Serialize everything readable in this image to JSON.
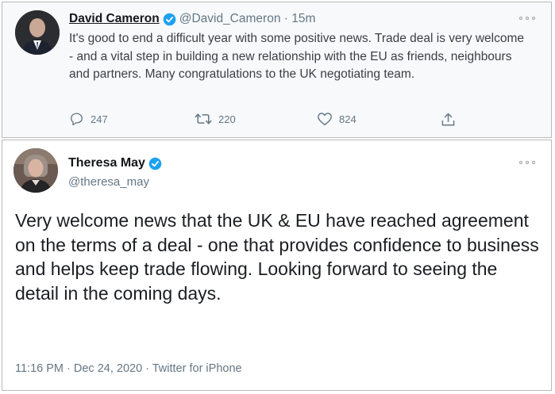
{
  "tweet1": {
    "name": "David Cameron",
    "handle": "@David_Cameron · 15m",
    "text": "It's good to end a difficult year with some positive news. Trade deal is very welcome - and a vital step in building a new relationship with the EU as friends, neighbours and partners. Many congratulations to the UK negotiating team.",
    "actions": {
      "replies": "247",
      "retweets": "220",
      "likes": "824"
    }
  },
  "tweet2": {
    "name": "Theresa May",
    "handle": "@theresa_may",
    "text": "Very welcome news that the UK & EU have reached agreement on the terms of a deal - one that provides confidence to business and helps keep trade flowing. Looking forward to seeing the detail in the coming days.",
    "meta": "11:16 PM · Dec 24, 2020 · Twitter for iPhone"
  },
  "icons": {
    "verified": "verified-badge-icon",
    "reply": "reply-icon",
    "retweet": "retweet-icon",
    "like": "heart-icon",
    "share": "share-icon",
    "more": "more-options-icon"
  },
  "colors": {
    "verified": "#1da1f2",
    "secondary_text": "#657786"
  }
}
